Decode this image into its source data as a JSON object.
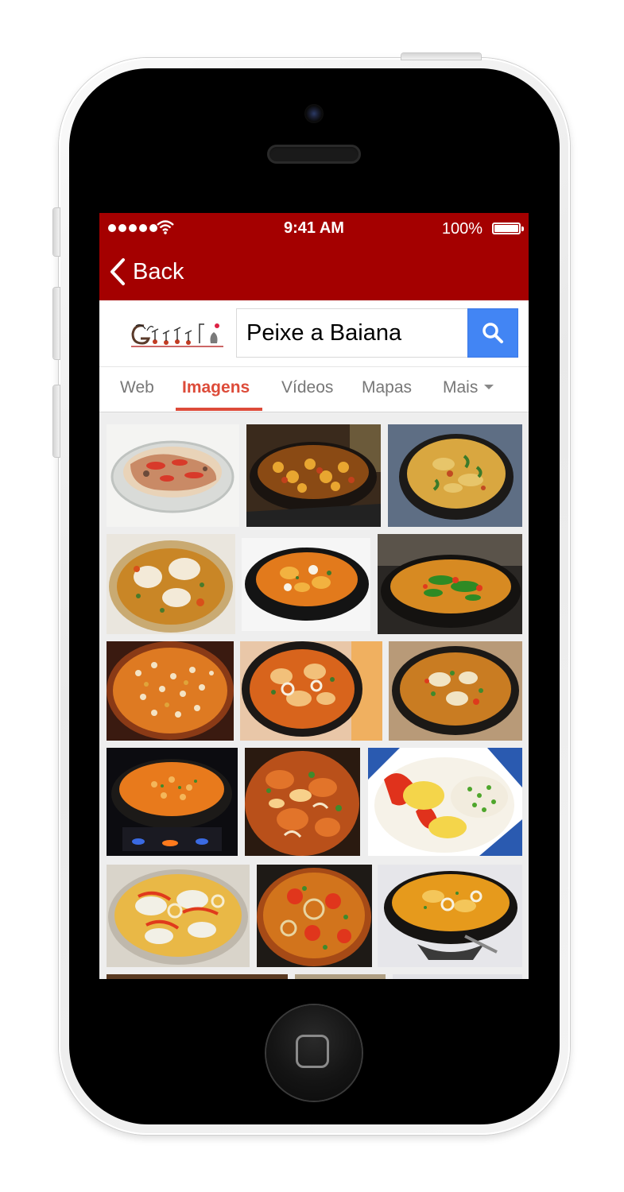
{
  "status_bar": {
    "time": "9:41 AM",
    "battery": "100%"
  },
  "nav": {
    "back_label": "Back"
  },
  "search": {
    "query": "Peixe a Baiana"
  },
  "tabs": [
    {
      "label": "Web",
      "active": false
    },
    {
      "label": "Imagens",
      "active": true
    },
    {
      "label": "Vídeos",
      "active": false
    },
    {
      "label": "Mapas",
      "active": false
    },
    {
      "label": "Mais",
      "active": false
    }
  ],
  "colors": {
    "header": "#a40000",
    "active_tab": "#dd4b39",
    "search_button": "#4285f4"
  },
  "icons": [
    "wifi-icon",
    "battery-icon",
    "back-chevron-icon",
    "search-icon",
    "dropdown-caret-icon",
    "home-button-icon"
  ]
}
